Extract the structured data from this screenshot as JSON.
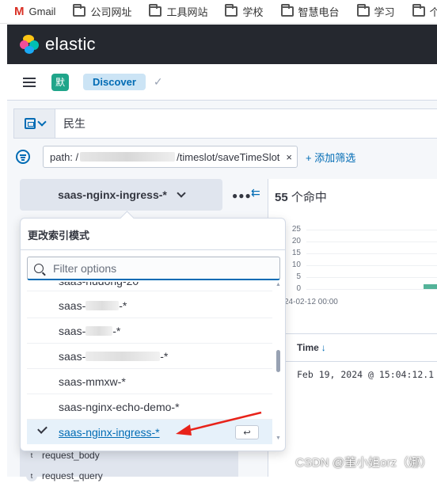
{
  "bookmarks": [
    {
      "label": "Gmail",
      "icon": "gmail-icon"
    },
    {
      "label": "公司网址",
      "icon": "folder-icon"
    },
    {
      "label": "工具网站",
      "icon": "folder-icon"
    },
    {
      "label": "学校",
      "icon": "folder-icon"
    },
    {
      "label": "智慧电台",
      "icon": "folder-icon"
    },
    {
      "label": "学习",
      "icon": "folder-icon"
    },
    {
      "label": "个",
      "icon": "folder-icon"
    }
  ],
  "header": {
    "brand": "elastic"
  },
  "nav": {
    "space_avatar": "默",
    "app": "Discover"
  },
  "query": {
    "text": "民生"
  },
  "filter": {
    "pill_prefix": "path: /",
    "pill_suffix": "/timeslot/saveTimeSlot",
    "close": "×",
    "add_label": "+ 添加筛选"
  },
  "index_pattern": {
    "current": "saas-nginx-ingress-*"
  },
  "popover": {
    "title": "更改索引模式",
    "search_placeholder": "Filter options",
    "options": [
      {
        "prefix": "saas-hudong-20",
        "suffix": ""
      },
      {
        "prefix": "saas-",
        "suffix": "-*"
      },
      {
        "prefix": "saas-",
        "suffix": "-*"
      },
      {
        "prefix": "saas-",
        "suffix": "-*"
      },
      {
        "prefix": "saas-mmxw-*",
        "suffix": ""
      },
      {
        "prefix": "saas-nginx-echo-demo-*",
        "suffix": ""
      },
      {
        "prefix": "saas-nginx-ingress-*",
        "suffix": "",
        "selected": true
      }
    ],
    "enter_key": "↩"
  },
  "fields": [
    {
      "type": "t",
      "name": "request_body"
    },
    {
      "type": "t",
      "name": "request_query"
    }
  ],
  "hits": {
    "count": "55",
    "label": " 个命中"
  },
  "chart_data": {
    "type": "bar",
    "yticks": [
      "25",
      "20",
      "15",
      "10",
      "5",
      "0"
    ],
    "ylim": [
      0,
      25
    ],
    "x_start_label": "24-02-12 00:00",
    "values": [
      {
        "x": "2024-02-19",
        "y": 2
      }
    ]
  },
  "table": {
    "column": "Time",
    "sort_arrow": "↓",
    "first_cell": "Feb 19, 2024 @ 15:04:12.1"
  },
  "watermark": "CSDN @董小姐orz（娜）"
}
